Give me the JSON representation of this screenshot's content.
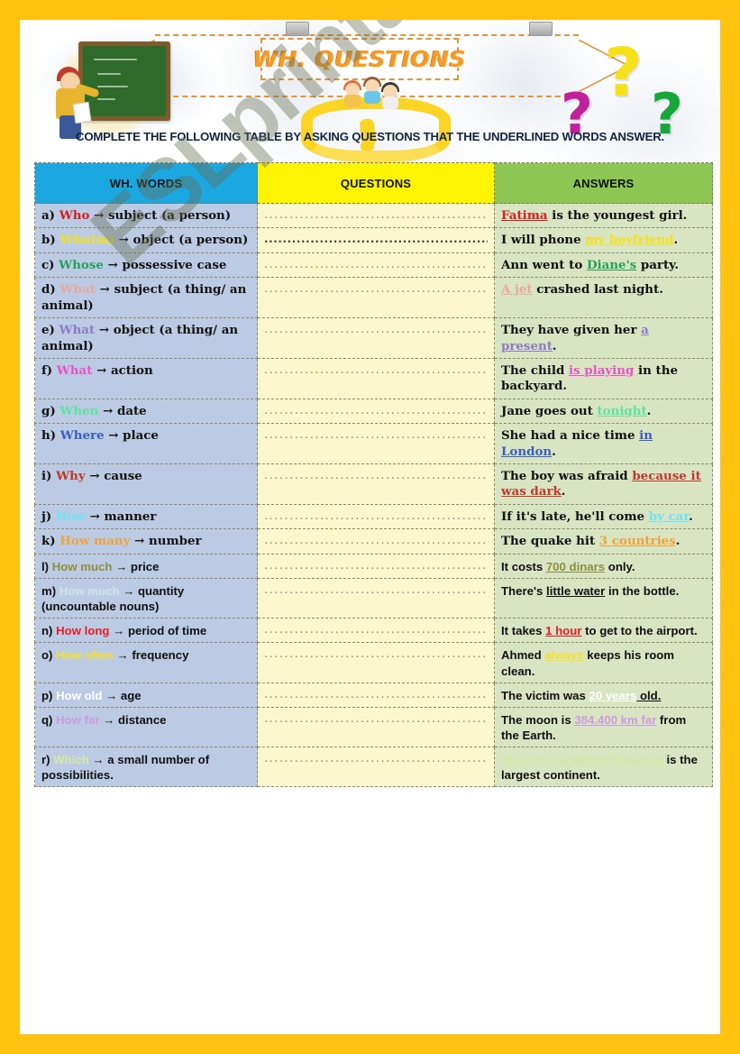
{
  "page": {
    "title": "WH. QUESTIONS",
    "instruction": "COMPLETE THE FOLLOWING TABLE BY ASKING QUESTIONS THAT THE UNDERLINED WORDS ANSWER.",
    "watermark": "ESLprintables.com",
    "border_color": "#FFC20E",
    "title_color": "#F59B29"
  },
  "table": {
    "headers": {
      "wh_words": "WH. WORDS",
      "questions": "QUESTIONS",
      "answers": "ANSWERS"
    },
    "header_colors": {
      "wh_words": "#1BA7E0",
      "questions": "#FCF403",
      "answers": "#8DC653"
    },
    "column_colors": {
      "wh_words": "#BACBE3",
      "questions": "#FCF8CE",
      "answers": "#D9E4C3"
    },
    "dots": "........................................",
    "rows": [
      {
        "letter": "a)",
        "wh_word": "Who",
        "wh_color": "#D81E1E",
        "function": "subject (a person)",
        "question": "",
        "answer_before": "",
        "answer_underlined": "Fatima",
        "answer_underline_color": "#D81E1E",
        "answer_after": " is the youngest girl."
      },
      {
        "letter": "b)",
        "wh_word": "Who(m)",
        "wh_color": "#F4E118",
        "function": "object (a person)",
        "question": "",
        "answer_before": "I will phone ",
        "answer_underlined": "my boyfriend",
        "answer_underline_color": "#F4E118",
        "answer_after": "."
      },
      {
        "letter": "c)",
        "wh_word": "Whose",
        "wh_color": "#27A05E",
        "function": "possessive case",
        "question": "",
        "answer_before": "Ann went to ",
        "answer_underlined": "Diane's",
        "answer_underline_color": "#27A05E",
        "answer_after": " party."
      },
      {
        "letter": "d)",
        "wh_word": "What",
        "wh_color": "#E8A9A0",
        "function": "subject (a thing/ an animal)",
        "question": "",
        "answer_before": "",
        "answer_underlined": "A jet",
        "answer_underline_color": "#E8A9A0",
        "answer_after": " crashed last night."
      },
      {
        "letter": "e)",
        "wh_word": "What",
        "wh_color": "#8E7CC3",
        "function": "object (a thing/ an animal)",
        "question": "",
        "answer_before": "They have given her ",
        "answer_underlined": "a present",
        "answer_underline_color": "#8E7CC3",
        "answer_after": "."
      },
      {
        "letter": "f)",
        "wh_word": "What",
        "wh_color": "#E854C8",
        "function": "action",
        "question": "",
        "answer_before": "The child ",
        "answer_underlined": "is playing",
        "answer_underline_color": "#E854C8",
        "answer_after": " in the backyard."
      },
      {
        "letter": "g)",
        "wh_word": "When",
        "wh_color": "#5FE3A1",
        "function": "date",
        "question": "",
        "answer_before": "Jane goes out ",
        "answer_underlined": "tonight",
        "answer_underline_color": "#5FE3A1",
        "answer_after": "."
      },
      {
        "letter": "h)",
        "wh_word": "Where",
        "wh_color": "#3B5FC0",
        "function": "place",
        "question": "",
        "answer_before": "She had a nice time ",
        "answer_underlined": "in London",
        "answer_underline_color": "#3B5FC0",
        "answer_after": "."
      },
      {
        "letter": "i)",
        "wh_word": "Why",
        "wh_color": "#C0392B",
        "function": "cause",
        "question": "",
        "answer_before": "The boy was afraid ",
        "answer_underlined": "because it was dark",
        "answer_underline_color": "#C0392B",
        "answer_after": "."
      },
      {
        "letter": "j)",
        "wh_word": "How",
        "wh_color": "#6FE4F4",
        "function": "manner",
        "question": "",
        "answer_before": "If it's late, he'll come ",
        "answer_underlined": "by car",
        "answer_underline_color": "#6FE4F4",
        "answer_after": "."
      },
      {
        "letter": "k)",
        "wh_word": "How many",
        "wh_color": "#F0A33C",
        "function": "number",
        "question": "",
        "answer_before": "The quake hit ",
        "answer_underlined": "3 countries",
        "answer_underline_color": "#F0A33C",
        "answer_after": "."
      },
      {
        "letter": "l)",
        "wh_word": "How much",
        "wh_color": "#8C9040",
        "function": "price",
        "question": "",
        "answer_before": "It costs ",
        "answer_underlined": "700 dinars",
        "answer_underline_color": "#8C9040",
        "answer_after": " only."
      },
      {
        "letter": "m)",
        "wh_word": "How much",
        "wh_color": "#CFE4E8",
        "function": "quantity (uncountable nouns)",
        "question": "",
        "answer_before": "There's ",
        "answer_underlined": "little water",
        "answer_underline_color": "#111111",
        "answer_after": " in the bottle."
      },
      {
        "letter": "n)",
        "wh_word": "How long",
        "wh_color": "#ED1C24",
        "function": "period of time",
        "question": "",
        "answer_before": "It takes ",
        "answer_underlined": "1 hour",
        "answer_underline_color": "#ED1C24",
        "answer_after": " to get to the airport."
      },
      {
        "letter": "o)",
        "wh_word": "How often",
        "wh_color": "#F7E029",
        "function": "frequency",
        "question": "",
        "answer_before": "Ahmed ",
        "answer_underlined": "always",
        "answer_underline_color": "#F7E029",
        "answer_after": " keeps his room clean."
      },
      {
        "letter": "p)",
        "wh_word": "How old",
        "wh_color": "#FFFFFF",
        "function": "age",
        "question": "",
        "answer_before": "The victim was ",
        "answer_underlined": "20 years",
        "answer_underline_color": "#FFFFFF",
        "answer_after_underlined": " old.",
        "answer_after": ""
      },
      {
        "letter": "q)",
        "wh_word": "How far",
        "wh_color": "#CE9BE0",
        "function": "distance",
        "question": "",
        "answer_before": "The moon is ",
        "answer_underlined": "384.400 km far",
        "answer_underline_color": "#CE9BE0",
        "answer_after": " from the Earth."
      },
      {
        "letter": "r)",
        "wh_word": "Which",
        "wh_color": "#D6E8A0",
        "function": "a small number of possibilities.",
        "question": "",
        "answer_before": "",
        "answer_underlined": "Africa or Europe or Australia",
        "answer_underline_color": "#D6E8A0",
        "answer_after": " is the largest continent."
      }
    ]
  }
}
